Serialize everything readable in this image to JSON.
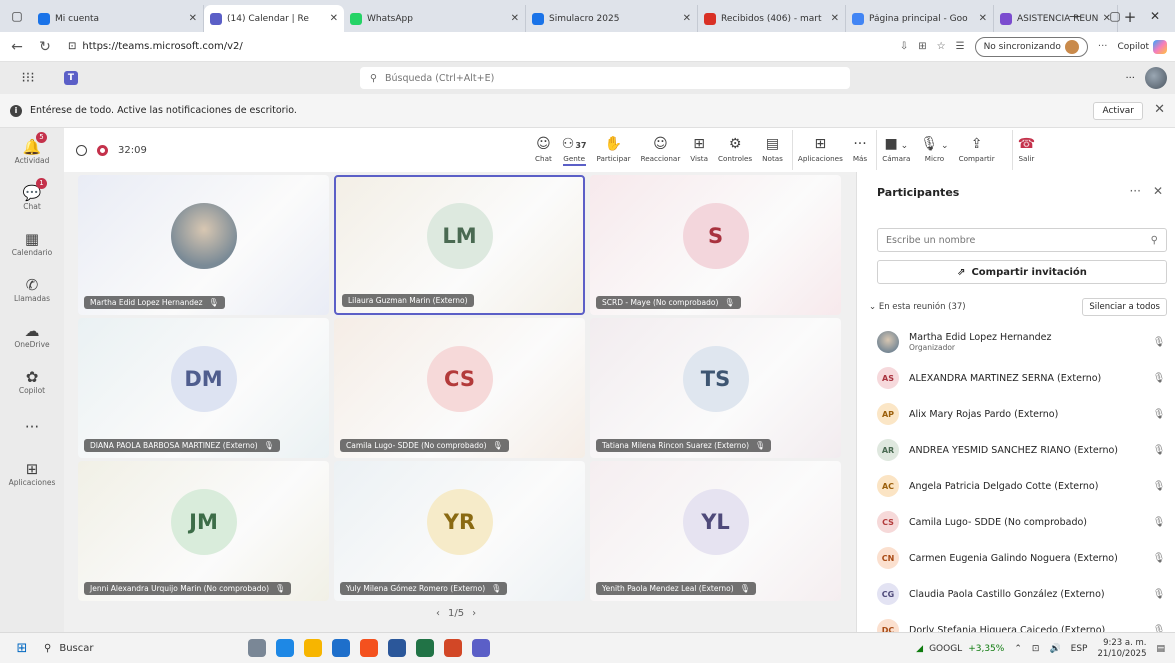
{
  "browser": {
    "tabs": [
      {
        "title": "Mi cuenta",
        "color": "#1a73e8",
        "width": 172
      },
      {
        "title": "(14) Calendar | Re",
        "color": "#5b5fc7",
        "width": 140,
        "active": true
      },
      {
        "title": "WhatsApp",
        "color": "#25d366",
        "width": 182
      },
      {
        "title": "Simulacro 2025",
        "color": "#1a73e8",
        "width": 172
      },
      {
        "title": "Recibidos (406) - mart",
        "color": "#d93025",
        "width": 148
      },
      {
        "title": "Página principal - Goo",
        "color": "#4285f4",
        "width": 148
      },
      {
        "title": "ASISTENCIA REUNION",
        "color": "#7b4ccf",
        "width": 124
      }
    ],
    "url": "https://teams.microsoft.com/v2/",
    "sync_label": "No sincronizando",
    "copilot_label": "Copilot"
  },
  "teams": {
    "search_placeholder": "Búsqueda (Ctrl+Alt+E)",
    "notification": "Entérese de todo. Active las notificaciones de escritorio.",
    "activate_label": "Activar",
    "rail": [
      {
        "label": "Actividad",
        "icon": "🔔",
        "badge": "5"
      },
      {
        "label": "Chat",
        "icon": "💬",
        "badge": "1"
      },
      {
        "label": "Calendario",
        "icon": "▦"
      },
      {
        "label": "Llamadas",
        "icon": "✆"
      },
      {
        "label": "OneDrive",
        "icon": "☁"
      },
      {
        "label": "Copilot",
        "icon": "✿"
      },
      {
        "label": "",
        "icon": "···"
      },
      {
        "label": "Aplicaciones",
        "icon": "⊞"
      }
    ]
  },
  "meeting": {
    "timer": "32:09",
    "participant_count": "37",
    "toolbar": [
      {
        "label": "Chat",
        "icon": "☺"
      },
      {
        "label": "Gente",
        "icon": "⚇",
        "selected": true
      },
      {
        "label": "Participar",
        "icon": "✋"
      },
      {
        "label": "Reaccionar",
        "icon": "☺"
      },
      {
        "label": "Vista",
        "icon": "⊞"
      },
      {
        "label": "Controles",
        "icon": "⚙"
      },
      {
        "label": "Notas",
        "icon": "▤"
      },
      {
        "label": "Aplicaciones",
        "icon": "⊞"
      },
      {
        "label": "Más",
        "icon": "···"
      },
      {
        "label": "Cámara",
        "icon": "■"
      },
      {
        "label": "Micro",
        "icon": "🎙"
      },
      {
        "label": "Compartir",
        "icon": "⇪"
      },
      {
        "label": "Salir",
        "icon": "☎"
      }
    ],
    "tiles": [
      {
        "initials": "",
        "name": "Martha Edid Lopez Hernandez",
        "bg": "#e9ecf5",
        "avbg": "#9fb0bf",
        "avfg": "#fff",
        "photo": true
      },
      {
        "initials": "LM",
        "name": "Lilaura Guzman Marin (Externo)",
        "bg": "#f3efe6",
        "avbg": "#dde9df",
        "avfg": "#4a6a52",
        "speaking": true
      },
      {
        "initials": "S",
        "name": "SCRD - Maye (No comprobado)",
        "bg": "#f7e9ec",
        "avbg": "#f3d6dc",
        "avfg": "#a8323e"
      },
      {
        "initials": "DM",
        "name": "DIANA PAOLA BARBOSA MARTINEZ (Externo)",
        "bg": "#eaf1f3",
        "avbg": "#dde3f2",
        "avfg": "#4f5d8e"
      },
      {
        "initials": "CS",
        "name": "Camila Lugo- SDDE (No comprobado)",
        "bg": "#f5ede6",
        "avbg": "#f6d9d9",
        "avfg": "#b33a3a"
      },
      {
        "initials": "TS",
        "name": "Tatiana Milena Rincon Suarez (Externo)",
        "bg": "#f2ecef",
        "avbg": "#dfe6ef",
        "avfg": "#3e5672"
      },
      {
        "initials": "JM",
        "name": "Jenni Alexandra Urquijo Marin (No comprobado)",
        "bg": "#f1f0e6",
        "avbg": "#d9ecdb",
        "avfg": "#3d6d48"
      },
      {
        "initials": "YR",
        "name": "Yuly Milena Gómez Romero (Externo)",
        "bg": "#ecf1f4",
        "avbg": "#f6ebc9",
        "avfg": "#8a6a12"
      },
      {
        "initials": "YL",
        "name": "Yenith Paola Mendez Leal (Externo)",
        "bg": "#f5eef0",
        "avbg": "#e6e3f1",
        "avfg": "#4f4a7a"
      }
    ],
    "pager": "1/5",
    "panel": {
      "title": "Participantes",
      "search_placeholder": "Escribe un nombre",
      "invite_label": "Compartir invitación",
      "section_label": "En esta reunión (37)",
      "mute_all_label": "Silenciar a todos",
      "people": [
        {
          "initials": "",
          "name": "Martha Edid Lopez Hernandez",
          "sub": "Organizador",
          "avbg": "#8d9aa6",
          "avfg": "#fff"
        },
        {
          "initials": "AS",
          "name": "ALEXANDRA MARTINEZ SERNA (Externo)",
          "avbg": "#f6d9dc",
          "avfg": "#a8323e"
        },
        {
          "initials": "AP",
          "name": "Alix Mary Rojas Pardo (Externo)",
          "avbg": "#fbe6c6",
          "avfg": "#9b5f0b"
        },
        {
          "initials": "AR",
          "name": "ANDREA YESMID SANCHEZ RIAÑO (Externo)",
          "avbg": "#dfe8df",
          "avfg": "#4a6a52"
        },
        {
          "initials": "AC",
          "name": "Angela Patricia Delgado Cotte (Externo)",
          "avbg": "#fbe4c4",
          "avfg": "#9b5f0b"
        },
        {
          "initials": "CS",
          "name": "Camila Lugo- SDDE (No comprobado)",
          "avbg": "#f6d9d9",
          "avfg": "#b33a3a"
        },
        {
          "initials": "CN",
          "name": "Carmen Eugenia Galindo Noguera (Externo)",
          "avbg": "#fbe0cf",
          "avfg": "#a84a14"
        },
        {
          "initials": "CG",
          "name": "Claudia Paola Castillo González (Externo)",
          "avbg": "#e3e3f3",
          "avfg": "#4f4a7a"
        },
        {
          "initials": "DC",
          "name": "Dorly Stefania Higuera Caicedo (Externo)",
          "avbg": "#fbe0cf",
          "avfg": "#a84a14"
        }
      ]
    }
  },
  "taskbar": {
    "search_label": "Buscar",
    "stock_name": "GOOGL",
    "stock_change": "+3,35%",
    "lang": "ESP",
    "time": "9:23 a. m.",
    "date": "21/10/2025",
    "apps": [
      "#7a8796",
      "#1e88e5",
      "#f7b500",
      "#1e6fcb",
      "#f4511e",
      "#2b579a",
      "#217346",
      "#d24726",
      "#5b5fc7"
    ]
  }
}
